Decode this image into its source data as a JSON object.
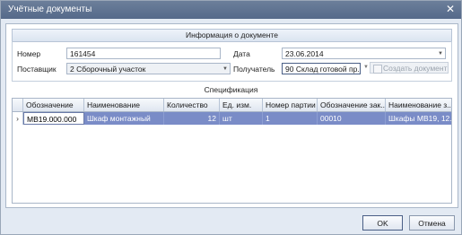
{
  "window": {
    "title": "Учётные документы"
  },
  "info": {
    "header": "Информация о документе",
    "number_label": "Номер",
    "number_value": "161454",
    "date_label": "Дата",
    "date_value": "23.06.2014",
    "supplier_label": "Поставщик",
    "supplier_value": "2 Сборочный участок",
    "recipient_label": "Получатель",
    "recipient_value": "90 Склад готовой пр...",
    "create_doc_label": "Создать документ"
  },
  "spec": {
    "header": "Спецификация",
    "columns": [
      "Обозначение",
      "Наименование",
      "Количество",
      "Ед. изм.",
      "Номер партии",
      "Обозначение зак...",
      "Наименование з..."
    ],
    "rows": [
      {
        "indicator": "›",
        "designation": "МВ19.000.000",
        "name": "Шкаф монтажный",
        "qty": "12",
        "unit": "шт",
        "batch": "1",
        "order_designation": "00010",
        "order_name": "Шкафы МВ19, 12..."
      }
    ]
  },
  "buttons": {
    "ok": "OK",
    "cancel": "Отмена"
  }
}
